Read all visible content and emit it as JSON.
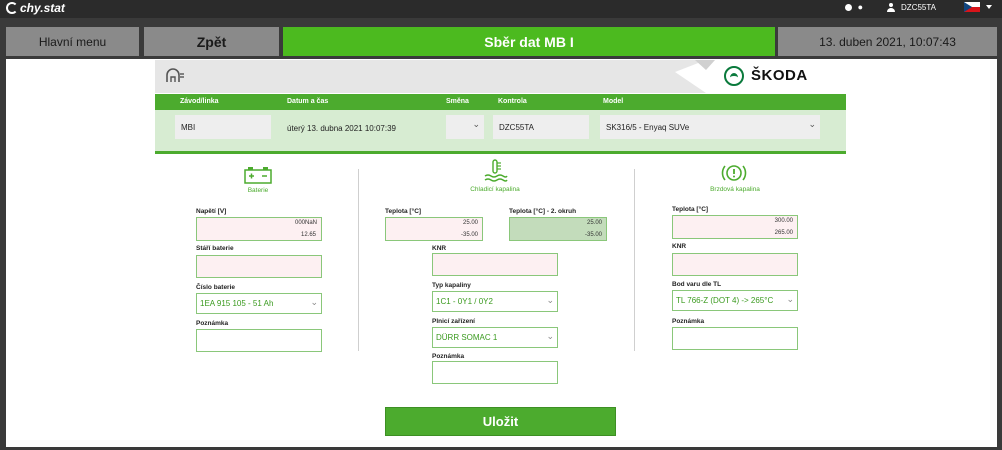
{
  "app": {
    "brand": "chy.stat",
    "user": "DZC55TA"
  },
  "nav": {
    "menu": "Hlavní menu",
    "back": "Zpět",
    "title": "Sběr dat MB I",
    "datetime": "13. duben 2021, 10:07:43"
  },
  "banner": {
    "brand_text": "ŠKODA"
  },
  "filter": {
    "labels": {
      "plant": "Závod/linka",
      "datetime": "Datum a čas",
      "shift": "Směna",
      "check": "Kontrola",
      "model": "Model"
    },
    "values": {
      "plant": "MBI",
      "datetime": "úterý 13. dubna 2021 10:07:39",
      "shift": "",
      "check": "DZC55TA",
      "model": "SK316/5 - Enyaq SUVe"
    }
  },
  "battery": {
    "title": "Baterie",
    "voltage_label": "Napětí [V]",
    "voltage_top": "000NaN",
    "voltage_bottom": "12.65",
    "age_label": "Stáří baterie",
    "number_label": "Číslo baterie",
    "number_value": "1EA 915 105 - 51 Ah",
    "note_label": "Poznámka"
  },
  "coolant": {
    "title": "Chladicí kapalina",
    "temp_label": "Teplota [°C]",
    "temp_top": "25.00",
    "temp_bottom": "-35.00",
    "temp2_label": "Teplota [°C] - 2. okruh",
    "temp2_top": "25.00",
    "temp2_bottom": "-35.00",
    "knr_label": "KNR",
    "type_label": "Typ kapaliny",
    "type_value": "1C1 - 0Y1 / 0Y2",
    "filler_label": "Plnicí zařízení",
    "filler_value": "DÜRR SOMAC 1",
    "note_label": "Poznámka"
  },
  "brake": {
    "title": "Brzdová kapalina",
    "temp_label": "Teplota [°C]",
    "temp_top": "300.00",
    "temp_bottom": "265.00",
    "knr_label": "KNR",
    "boil_label": "Bod varu dle TL",
    "boil_value": "TL 766-Z (DOT 4) -> 265°C",
    "note_label": "Poznámka"
  },
  "actions": {
    "save": "Uložit"
  },
  "colors": {
    "accent": "#4cba1f",
    "band": "#4cab2e",
    "nav_gray": "#8a8a8a"
  }
}
